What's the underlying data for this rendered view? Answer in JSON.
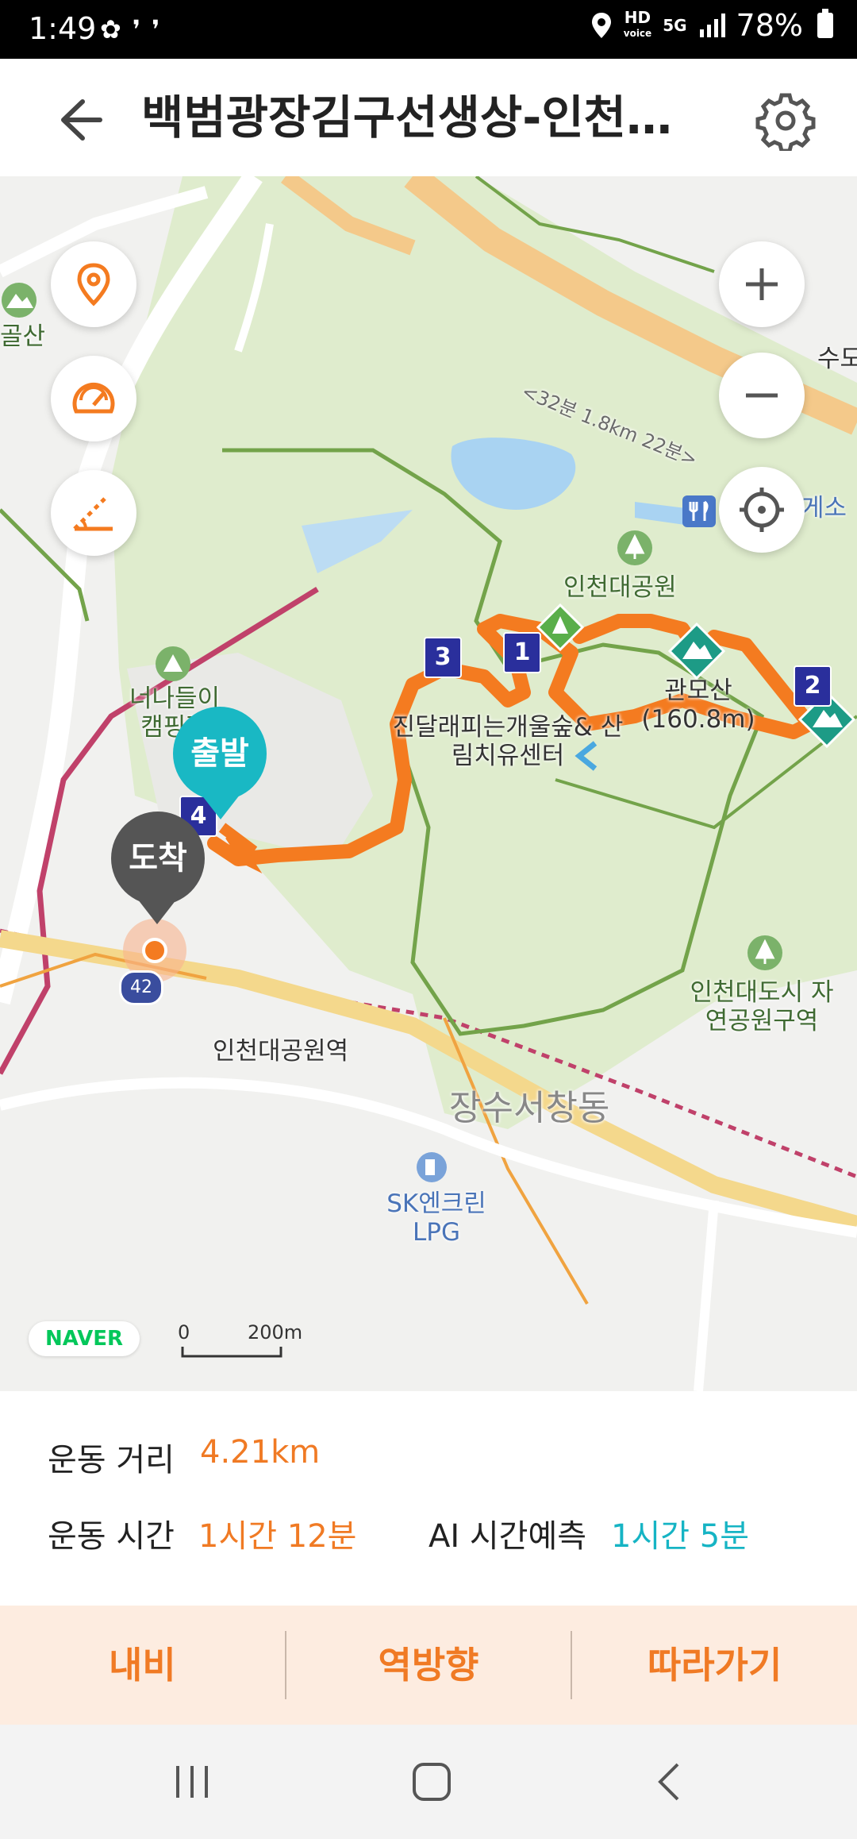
{
  "status_bar": {
    "time": "1:49",
    "battery": "78%",
    "hd_label": "HD",
    "voice_label": "voice",
    "network": "5G"
  },
  "header": {
    "title": "백범광장김구선생상-인천대공원",
    "back_icon": "arrow-left-icon",
    "settings_icon": "gear-icon"
  },
  "map": {
    "road_label": "<32분 1.8km 22분>",
    "labels": {
      "park": "인천대공원",
      "camping": "너나들이 캠핑장",
      "forest": "진달래피는개울숲& 산림치유센터",
      "mountain": "관모산 (160.8m)",
      "nature_park": "인천대도시 자연공원구역",
      "station": "인천대공원역",
      "district": "장수서창동",
      "gas_station": "SK엔크린 LPG",
      "left_edge": "골산",
      "right_top": "수도",
      "rest_area": "게소",
      "route_42": "42"
    },
    "markers": [
      "1",
      "2",
      "3",
      "4"
    ],
    "start_pin": "출발",
    "end_pin": "도착",
    "scale_zero": "0",
    "scale_label": "200m",
    "brand": "NAVER",
    "route_color": "#f47b20",
    "buttons": [
      "location-pin-icon",
      "speedometer-icon",
      "slope-icon",
      "zoom-in-icon",
      "zoom-out-icon",
      "crosshair-icon"
    ]
  },
  "stats": {
    "distance_label": "운동 거리",
    "distance_value": "4.21km",
    "time_label": "운동 시간",
    "time_value": "1시간 12분",
    "ai_label": "AI 시간예측",
    "ai_value": "1시간 5분"
  },
  "actions": {
    "navi": "내비",
    "reverse": "역방향",
    "follow": "따라가기"
  },
  "navigation_bar": [
    "recent-apps-icon",
    "home-icon",
    "back-icon"
  ]
}
